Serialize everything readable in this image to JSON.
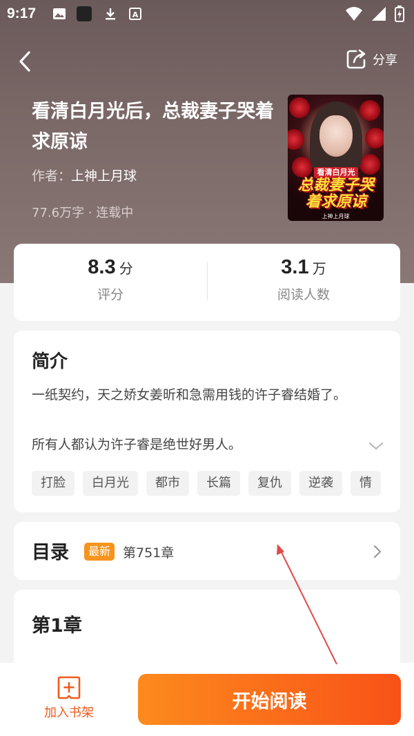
{
  "status_bar": {
    "time": "9:17"
  },
  "header": {
    "share_label": "分享"
  },
  "book": {
    "title": "看清白月光后，总裁妻子哭着求原谅",
    "author_prefix": "作者：",
    "author_name": "上神上月球",
    "meta": "77.6万字 · 连载中",
    "cover": {
      "line1": "看清白月光后",
      "line2": "总裁妻子哭着求原谅",
      "line3": "上神上月球"
    }
  },
  "stats": [
    {
      "value": "8.3",
      "unit": "分",
      "label": "评分"
    },
    {
      "value": "3.1",
      "unit": "万",
      "label": "阅读人数"
    }
  ],
  "intro": {
    "heading": "简介",
    "paragraph1": "一纸契约，天之娇女姜昕和急需用钱的许子睿结婚了。",
    "paragraph2": "所有人都认为许子睿是绝世好男人。",
    "tags": [
      "打脸",
      "白月光",
      "都市",
      "长篇",
      "复仇",
      "逆袭",
      "情"
    ]
  },
  "toc": {
    "heading": "目录",
    "badge": "最新",
    "latest_chapter": "第751章"
  },
  "first_chapter": {
    "heading": "第1章"
  },
  "bottom_bar": {
    "shelf_label": "加入书架",
    "read_button": "开始阅读"
  },
  "colors": {
    "accent": "#f85218",
    "badge": "#f7941d",
    "annotation_arrow": "#e04a4a"
  }
}
